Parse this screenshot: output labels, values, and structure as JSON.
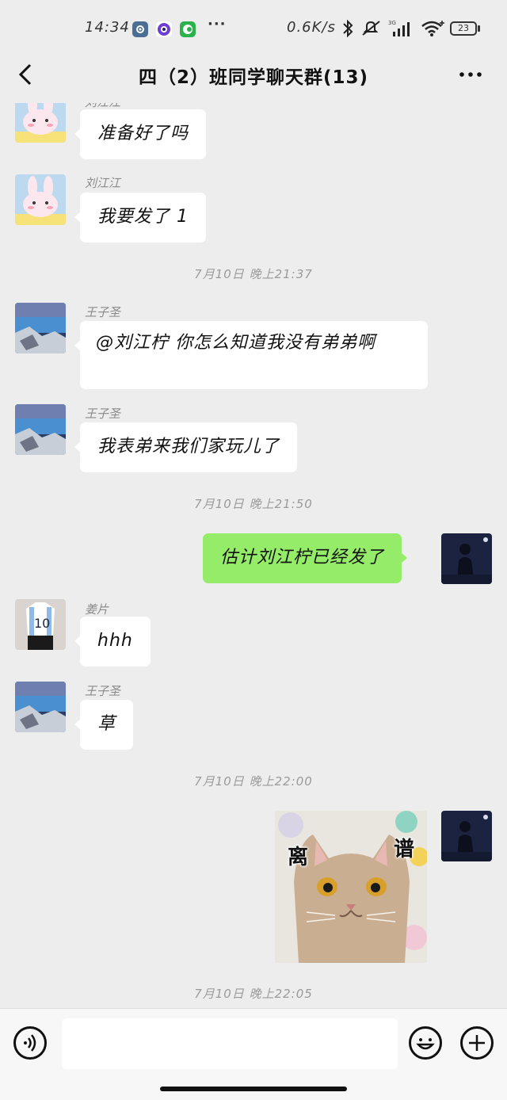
{
  "status_bar": {
    "time": "14:34",
    "more": "···",
    "network_speed": "0.6K/s",
    "battery": "23"
  },
  "nav": {
    "title": "四（2）班同学聊天群(13)"
  },
  "messages": [
    {
      "sender": "刘江江",
      "text": "准备好了吗"
    },
    {
      "sender": "刘江江",
      "text": "我要发了 1"
    },
    {
      "timestamp": "7月10日 晚上21:37"
    },
    {
      "sender": "王子圣",
      "text": "@刘江柠 你怎么知道我没有弟弟啊"
    },
    {
      "sender": "王子圣",
      "text": "我表弟来我们家玩儿了"
    },
    {
      "timestamp": "7月10日 晚上21:50"
    },
    {
      "self": true,
      "text": "估计刘江柠已经发了"
    },
    {
      "sender": "姜片",
      "text": "hhh"
    },
    {
      "sender": "王子圣",
      "text": "草"
    },
    {
      "timestamp": "7月10日 晚上22:00"
    },
    {
      "self": true,
      "sticker_left": "离",
      "sticker_right": "谱"
    },
    {
      "timestamp": "7月10日 晚上22:05"
    }
  ],
  "input": {
    "placeholder": ""
  },
  "colors": {
    "self_bubble": "#95ec69",
    "background": "#ededed"
  }
}
